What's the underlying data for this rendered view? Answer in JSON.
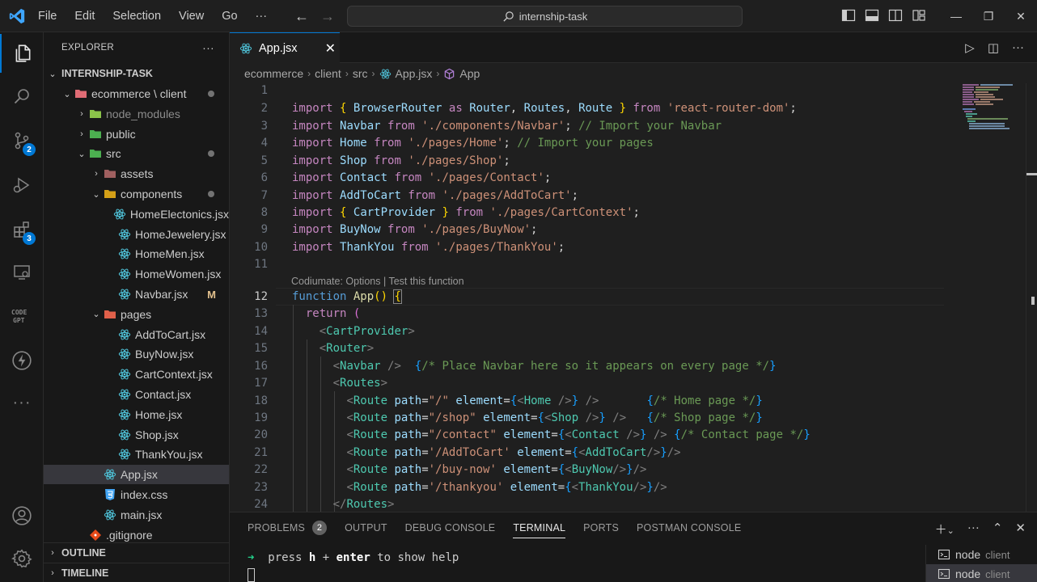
{
  "window": {
    "menu": [
      "File",
      "Edit",
      "Selection",
      "View",
      "Go",
      "···"
    ],
    "search": "internship-task"
  },
  "activity": {
    "source_control_badge": "2",
    "extensions_badge": "3"
  },
  "explorer": {
    "title": "EXPLORER",
    "more": "···",
    "root": "INTERNSHIP-TASK",
    "items": [
      {
        "label": "ecommerce \\ client",
        "type": "folder-open",
        "dot": true
      },
      {
        "label": "node_modules",
        "type": "folder"
      },
      {
        "label": "public",
        "type": "folder"
      },
      {
        "label": "src",
        "type": "folder-open",
        "dot": true
      },
      {
        "label": "assets",
        "type": "folder"
      },
      {
        "label": "components",
        "type": "folder-open",
        "dot": true
      },
      {
        "label": "HomeElectonics.jsx",
        "type": "react"
      },
      {
        "label": "HomeJewelery.jsx",
        "type": "react"
      },
      {
        "label": "HomeMen.jsx",
        "type": "react"
      },
      {
        "label": "HomeWomen.jsx",
        "type": "react"
      },
      {
        "label": "Navbar.jsx",
        "type": "react",
        "mod": "M"
      },
      {
        "label": "pages",
        "type": "folder-open"
      },
      {
        "label": "AddToCart.jsx",
        "type": "react"
      },
      {
        "label": "BuyNow.jsx",
        "type": "react"
      },
      {
        "label": "CartContext.jsx",
        "type": "react"
      },
      {
        "label": "Contact.jsx",
        "type": "react"
      },
      {
        "label": "Home.jsx",
        "type": "react"
      },
      {
        "label": "Shop.jsx",
        "type": "react"
      },
      {
        "label": "ThankYou.jsx",
        "type": "react"
      },
      {
        "label": "App.jsx",
        "type": "react"
      },
      {
        "label": "index.css",
        "type": "css"
      },
      {
        "label": "main.jsx",
        "type": "react"
      },
      {
        "label": ".gitignore",
        "type": "git"
      }
    ],
    "outline": "OUTLINE",
    "timeline": "TIMELINE"
  },
  "editor": {
    "tab": "App.jsx",
    "breadcrumb": [
      "ecommerce",
      "client",
      "src",
      "App.jsx",
      "App"
    ],
    "codelens": "Codiumate: Options | Test this function",
    "line_numbers": [
      "1",
      "2",
      "3",
      "4",
      "5",
      "6",
      "7",
      "8",
      "9",
      "10",
      "11",
      "12",
      "13",
      "14",
      "15",
      "16",
      "17",
      "18",
      "19",
      "20",
      "21",
      "22",
      "23",
      "24"
    ]
  },
  "panel": {
    "tabs": [
      "PROBLEMS",
      "OUTPUT",
      "DEBUG CONSOLE",
      "TERMINAL",
      "PORTS",
      "POSTMAN CONSOLE"
    ],
    "problems_count": "2",
    "terminal_prefix": "➜",
    "terminal_cmd_start": "press ",
    "terminal_key1": "h",
    "terminal_plus": " + ",
    "terminal_key2": "enter",
    "terminal_rest": " to show help",
    "terminals": [
      {
        "name": "node",
        "sub": "client"
      },
      {
        "name": "node",
        "sub": "client"
      }
    ]
  }
}
